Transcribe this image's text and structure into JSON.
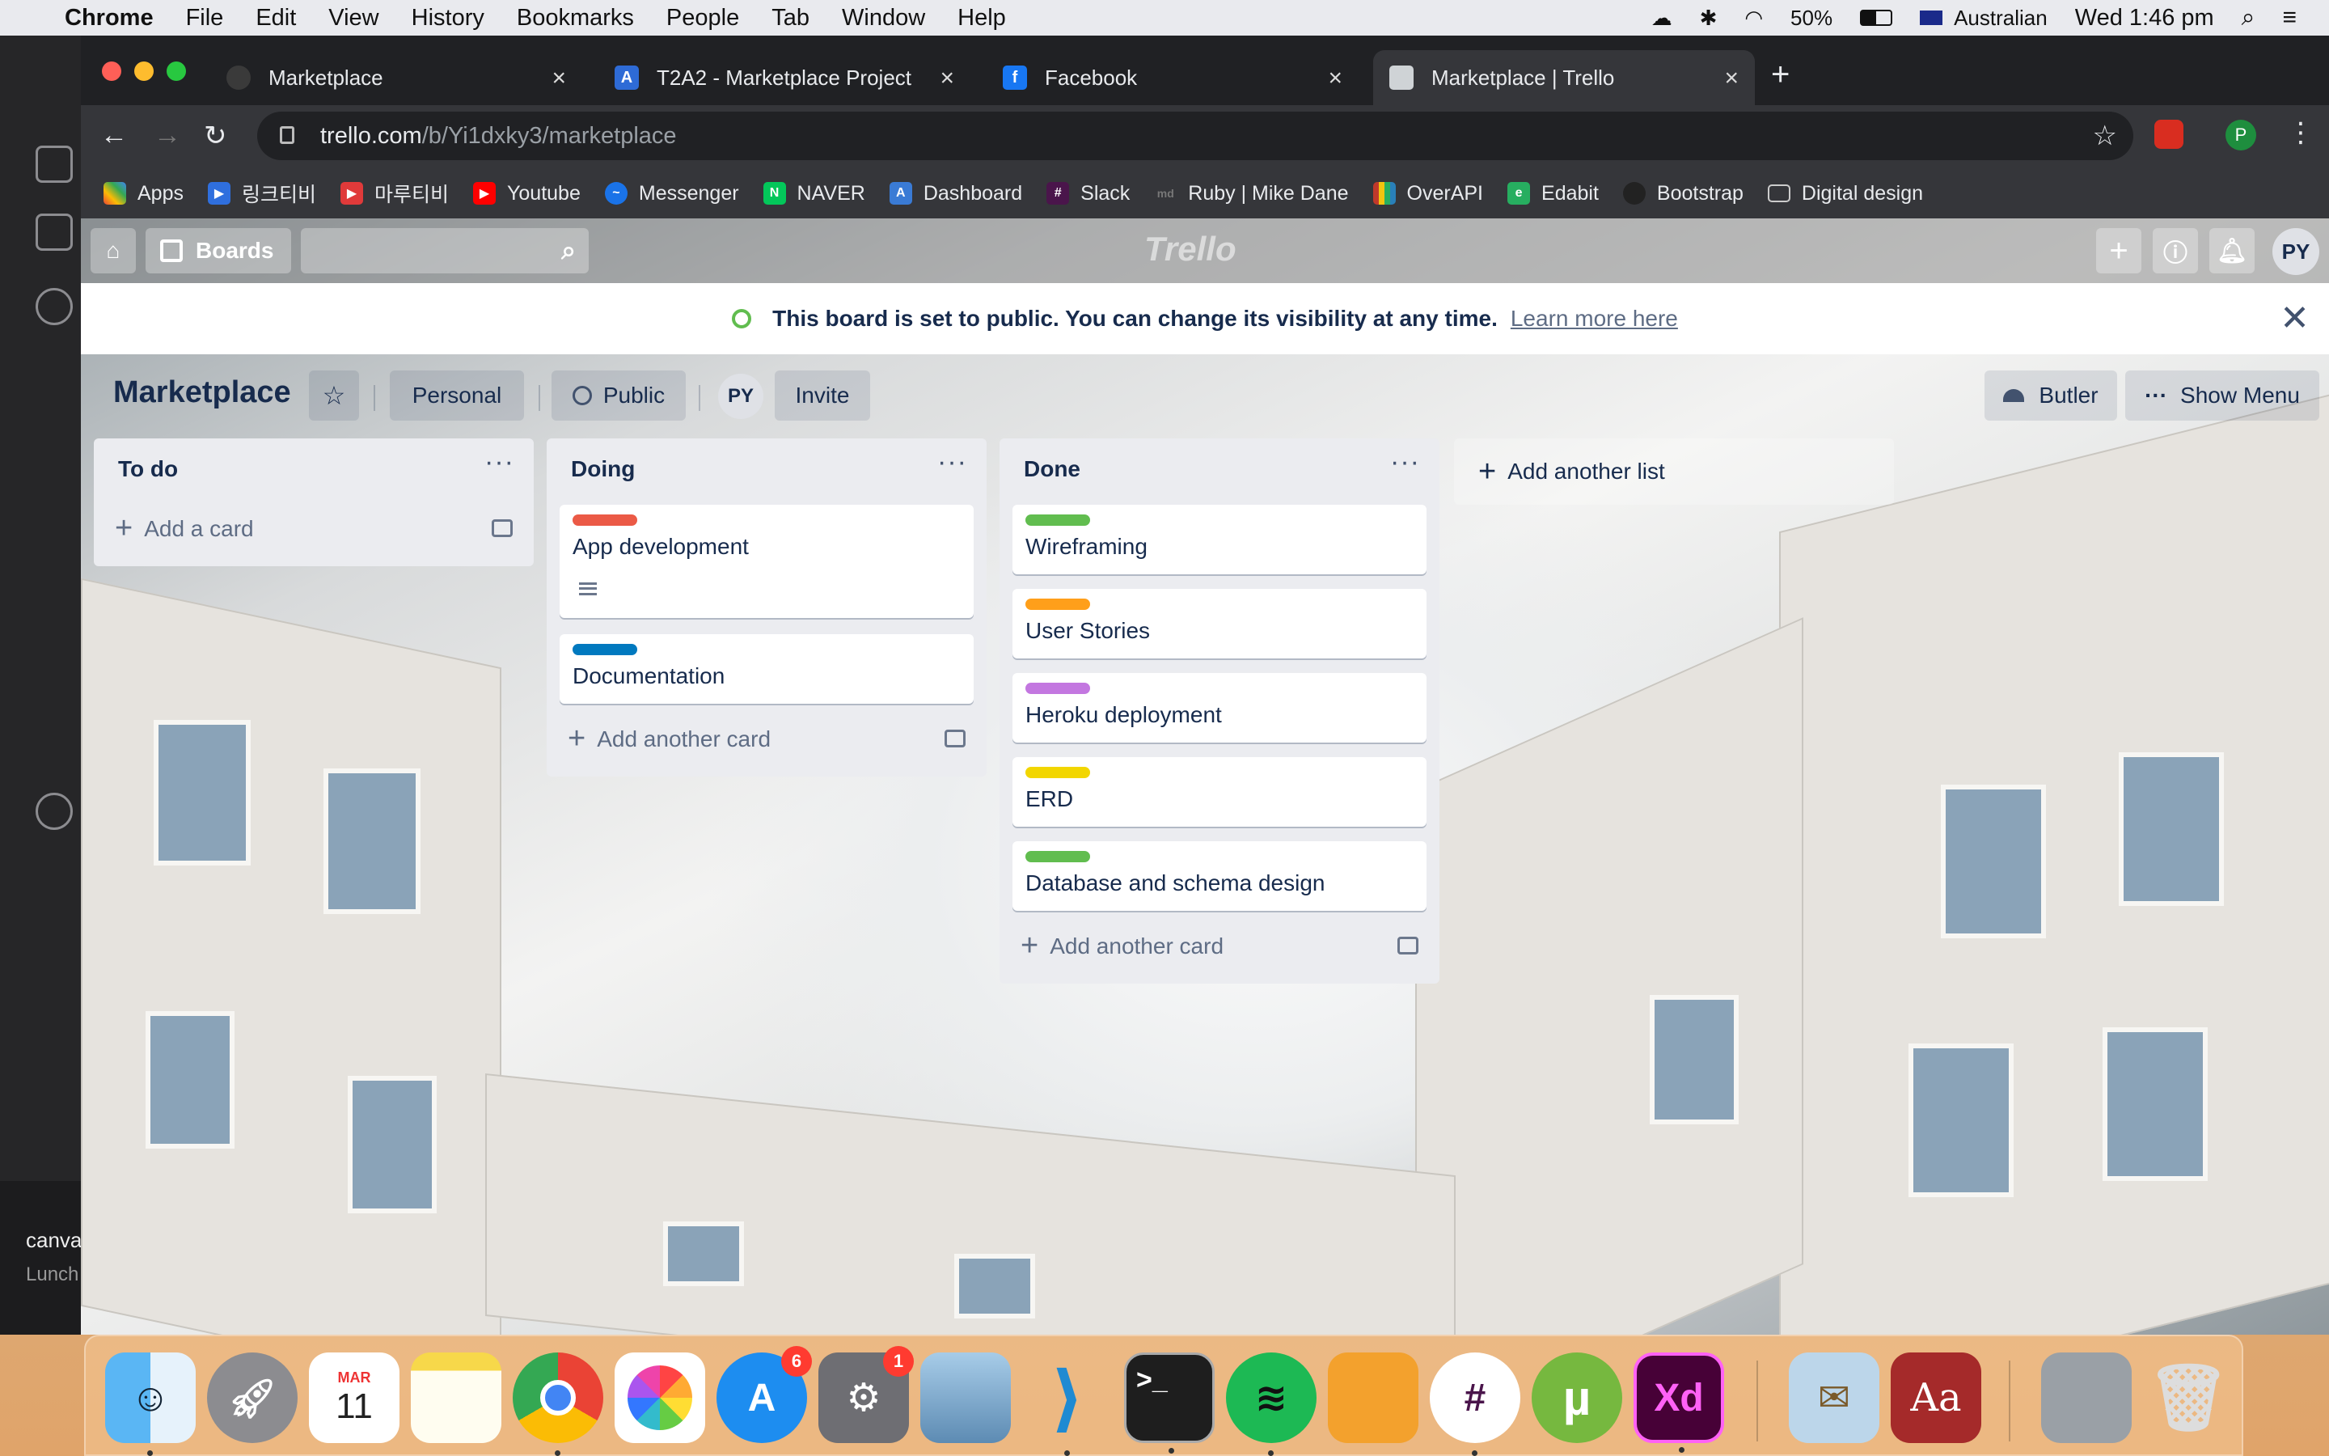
{
  "menubar": {
    "app": "Chrome",
    "items": [
      "File",
      "Edit",
      "View",
      "History",
      "Bookmarks",
      "People",
      "Tab",
      "Window",
      "Help"
    ],
    "battery": "50%",
    "input_source": "Australian",
    "clock": "Wed 1:46 pm"
  },
  "left_strip": {
    "bottom_title": "canva",
    "bottom_sub": "Lunch"
  },
  "tabs": [
    {
      "title": "Marketplace",
      "fav_color": "#3a3a3a",
      "fav_glyph": "M"
    },
    {
      "title": "T2A2 - Marketplace Project",
      "fav_color": "#2e6bd6",
      "fav_glyph": "A"
    },
    {
      "title": "Facebook",
      "fav_color": "#1877f2",
      "fav_glyph": "f"
    },
    {
      "title": "Marketplace | Trello",
      "fav_color": "#cfd3d6",
      "fav_glyph": "T"
    }
  ],
  "address": {
    "host": "trello.com",
    "path": "/b/Yi1dxky3/marketplace",
    "profile_initial": "P"
  },
  "bookmarks": [
    {
      "label": "Apps",
      "color": "#e8453c",
      "glyph": "⋮"
    },
    {
      "label": "링크티비",
      "color": "#2f6fde",
      "glyph": "▶"
    },
    {
      "label": "마루티비",
      "color": "#e03a3a",
      "glyph": "▶"
    },
    {
      "label": "Youtube",
      "color": "#ff0000",
      "glyph": "▶"
    },
    {
      "label": "Messenger",
      "color": "#1a73e8",
      "glyph": "~"
    },
    {
      "label": "NAVER",
      "color": "#03c75a",
      "glyph": "N"
    },
    {
      "label": "Dashboard",
      "color": "#3a7bd5",
      "glyph": "A"
    },
    {
      "label": "Slack",
      "color": "#4a154b",
      "glyph": "#"
    },
    {
      "label": "Ruby | Mike Dane",
      "color": "#555555",
      "glyph": "md"
    },
    {
      "label": "OverAPI",
      "color": "#c0392b",
      "glyph": "|"
    },
    {
      "label": "Edabit",
      "color": "#27ae60",
      "glyph": "e"
    },
    {
      "label": "Bootstrap",
      "color": "#222222",
      "glyph": "●"
    },
    {
      "label": "Digital design",
      "color": "#666666",
      "glyph": "▭"
    }
  ],
  "trello_nav": {
    "boards_label": "Boards",
    "logo": "Trello",
    "avatar": "PY"
  },
  "banner": {
    "message": "This board is set to public. You can change its visibility at any time.",
    "link": "Learn more here"
  },
  "board": {
    "title": "Marketplace",
    "team": "Personal",
    "visibility": "Public",
    "member": "PY",
    "invite": "Invite",
    "butler": "Butler",
    "show_menu": "Show Menu"
  },
  "lists": [
    {
      "title": "To do",
      "add_label": "Add a card",
      "cards": []
    },
    {
      "title": "Doing",
      "add_label": "Add another card",
      "cards": [
        {
          "label_color": "#eb5a46",
          "text": "App development",
          "has_description": true
        },
        {
          "label_color": "#0079bf",
          "text": "Documentation",
          "has_description": false
        }
      ]
    },
    {
      "title": "Done",
      "add_label": "Add another card",
      "cards": [
        {
          "label_color": "#61bd4f",
          "text": "Wireframing",
          "has_description": false
        },
        {
          "label_color": "#ff9f1a",
          "text": "User Stories",
          "has_description": false
        },
        {
          "label_color": "#c377e0",
          "text": "Heroku deployment",
          "has_description": false
        },
        {
          "label_color": "#f2d600",
          "text": "ERD",
          "has_description": false
        },
        {
          "label_color": "#61bd4f",
          "text": "Database and schema design",
          "has_description": false
        }
      ]
    }
  ],
  "add_list_label": "Add another list",
  "dock": {
    "apps": [
      "finder-icon",
      "launchpad-icon",
      "calendar-icon",
      "notes-icon",
      "chrome-icon",
      "photos-icon",
      "app-store-icon",
      "system-preferences-icon",
      "preview-icon",
      "vscode-icon",
      "terminal-icon",
      "spotify-icon",
      "pages-icon",
      "slack-icon",
      "utorrent-icon",
      "adobe-xd-icon",
      "mail-icon",
      "dictionary-icon",
      "downloads-icon",
      "trash-icon"
    ],
    "calendar_month": "MAR",
    "calendar_day": "11",
    "app_store_badge": "6",
    "system_prefs_badge": "1",
    "xd_label": "Xd",
    "dictionary_label": "Aa"
  }
}
